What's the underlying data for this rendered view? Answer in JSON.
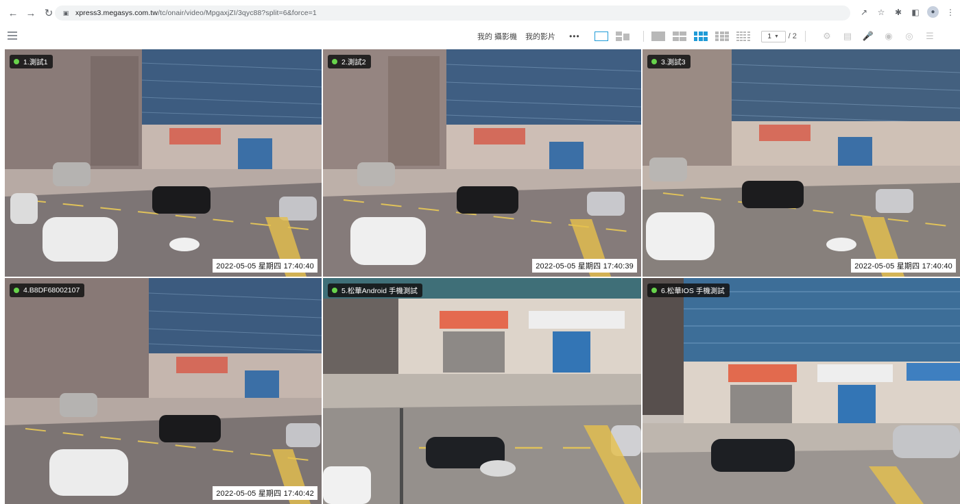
{
  "browser": {
    "back_icon": "arrow-left-icon",
    "forward_icon": "arrow-right-icon",
    "reload_icon": "reload-icon",
    "url_host": "xpress3.megasys.com.tw",
    "url_path": "/tc/onair/video/MpgaxjZI/3qyc88?split=6&force=1"
  },
  "toolbar": {
    "my_camera": "我的 攝影機",
    "my_videos": "我的影片",
    "more": "•••",
    "page_current": "1",
    "page_total": "/ 2",
    "accent_color": "#1f9bd7"
  },
  "cameras": [
    {
      "label": "1.測試1",
      "timestamp": "2022-05-05  星期四  17:40:40"
    },
    {
      "label": "2.測試2",
      "timestamp": "2022-05-05  星期四  17:40:39"
    },
    {
      "label": "3.測試3",
      "timestamp": "2022-05-05  星期四  17:40:40"
    },
    {
      "label": "4.B8DF68002107",
      "timestamp": "2022-05-05  星期四  17:40:42"
    },
    {
      "label": "5.松華Android 手機測試",
      "timestamp": ""
    },
    {
      "label": "6.松華IOS 手機測試",
      "timestamp": ""
    }
  ]
}
